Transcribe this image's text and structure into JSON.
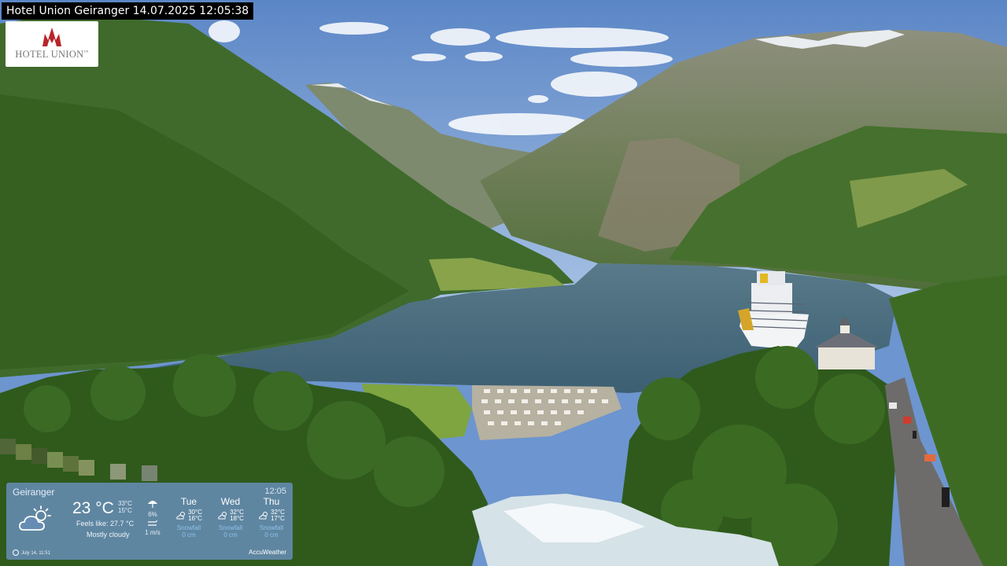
{
  "title_bar": {
    "text": "Hotel Union Geiranger 14.07.2025 12:05:38"
  },
  "logo": {
    "brand": "HOTEL UNION",
    "trademark": "™"
  },
  "weather": {
    "location": "Geiranger",
    "time": "12:05",
    "current": {
      "temperature": "23 °C",
      "high": "33°C",
      "low": "15°C",
      "precip_chance": "6%",
      "wind": "1 m/s",
      "feels_like": "Feels like: 27.7 °C",
      "condition": "Mostly cloudy",
      "icon": "partly-cloudy-icon"
    },
    "forecast": [
      {
        "day": "Tue",
        "high": "30°C",
        "low": "16°C",
        "snowfall_label": "Snowfall",
        "snowfall": "0 cm",
        "icon": "sun-cloud-icon"
      },
      {
        "day": "Wed",
        "high": "32°C",
        "low": "18°C",
        "snowfall_label": "Snowfall",
        "snowfall": "0 cm",
        "icon": "sun-cloud-icon"
      },
      {
        "day": "Thu",
        "high": "32°C",
        "low": "17°C",
        "snowfall_label": "Snowfall",
        "snowfall": "0 cm",
        "icon": "sun-cloud-icon"
      }
    ],
    "updated": "July 14, 11:51",
    "provider": "AccuWeather"
  },
  "colors": {
    "sky": "#6d95cf",
    "water": "#4a6e82",
    "forest": "#3d6a2a",
    "weather_panel": "#678cb4",
    "logo_red": "#b8242a"
  }
}
